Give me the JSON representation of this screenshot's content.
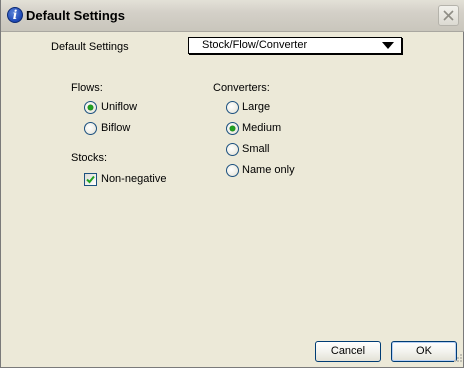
{
  "window": {
    "title": "Default Settings",
    "icon": "info-icon"
  },
  "settings_label": "Default Settings",
  "dropdown": {
    "value": "Stock/Flow/Converter"
  },
  "flows": {
    "label": "Flows:",
    "options": [
      {
        "label": "Uniflow",
        "checked": true
      },
      {
        "label": "Biflow",
        "checked": false
      }
    ]
  },
  "stocks": {
    "label": "Stocks:",
    "options": [
      {
        "label": "Non-negative",
        "checked": true
      }
    ]
  },
  "converters": {
    "label": "Converters:",
    "options": [
      {
        "label": "Large",
        "checked": false
      },
      {
        "label": "Medium",
        "checked": true
      },
      {
        "label": "Small",
        "checked": false
      },
      {
        "label": "Name only",
        "checked": false
      }
    ]
  },
  "buttons": {
    "cancel": "Cancel",
    "ok": "OK"
  },
  "colors": {
    "radio_dot": "#21a121",
    "button_border": "#003c74"
  }
}
